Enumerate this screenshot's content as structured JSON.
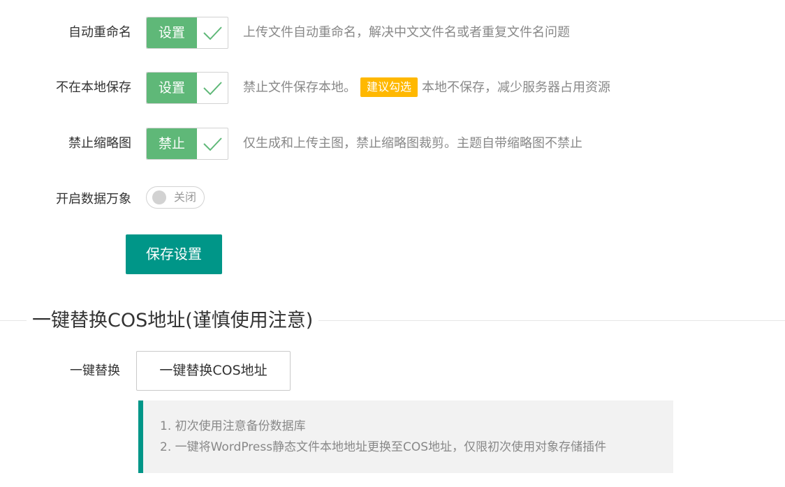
{
  "settings": {
    "rows": [
      {
        "label": "自动重命名",
        "checkbox_text": "设置",
        "checked": true,
        "hint_before": "上传文件自动重命名，解决中文文件名或者重复文件名问题"
      },
      {
        "label": "不在本地保存",
        "checkbox_text": "设置",
        "checked": true,
        "hint_before": "禁止文件保存本地。",
        "badge": "建议勾选",
        "hint_after": "本地不保存，减少服务器占用资源"
      },
      {
        "label": "禁止缩略图",
        "checkbox_text": "禁止",
        "checked": true,
        "hint_before": "仅生成和上传主图，禁止缩略图裁剪。主题自带缩略图不禁止"
      }
    ],
    "data_ci": {
      "label": "开启数据万象",
      "switch_text": "关闭",
      "enabled": false
    },
    "save_label": "保存设置"
  },
  "replace_section": {
    "title": "一键替换COS地址(谨慎使用注意)",
    "label": "一键替换",
    "button_label": "一键替换COS地址",
    "notes": [
      "1. 初次使用注意备份数据库",
      "2. 一键将WordPress静态文件本地地址更换至COS地址，仅限初次使用对象存储插件"
    ]
  },
  "colors": {
    "checkbox_green": "#5fb878",
    "primary_teal": "#009688",
    "badge_orange": "#ffb800",
    "hint_gray": "#888888"
  }
}
